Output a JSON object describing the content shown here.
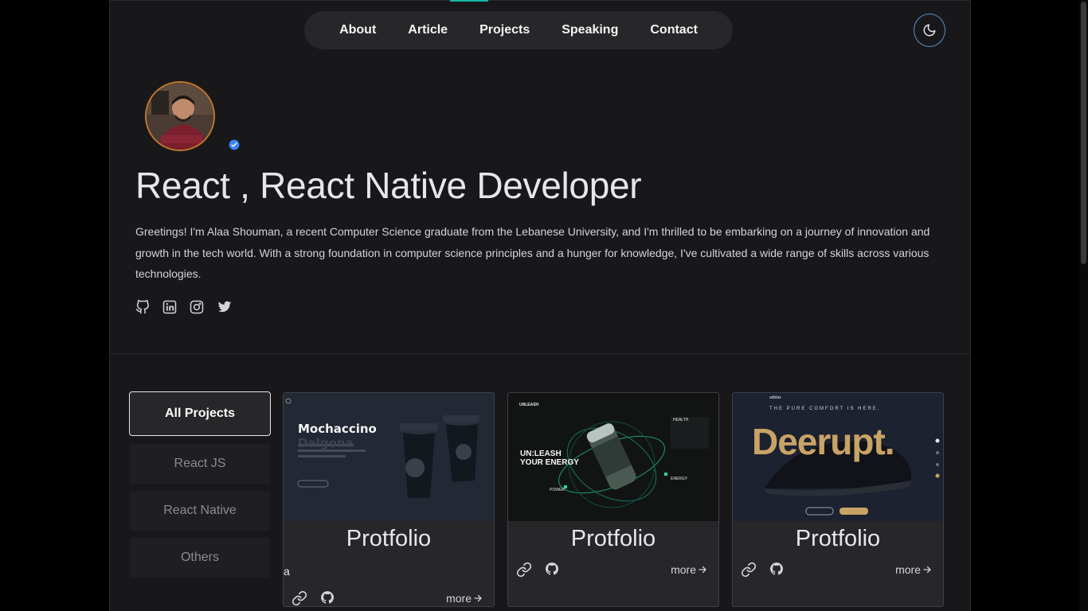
{
  "nav": {
    "items": [
      "About",
      "Article",
      "Projects",
      "Speaking",
      "Contact"
    ]
  },
  "hero": {
    "headline": "React , React Native Developer",
    "bio": "Greetings! I'm Alaa Shouman, a recent Computer Science graduate from the Lebanese University, and I'm thrilled to be embarking on a journey of innovation and growth in the tech world. With a strong foundation in computer science principles and a hunger for knowledge, I've cultivated a wide range of skills across various technologies."
  },
  "socials": [
    "github-icon",
    "linkedin-icon",
    "instagram-icon",
    "twitter-icon"
  ],
  "filters": [
    "All Projects",
    "React JS",
    "React Native",
    "Others"
  ],
  "cards": [
    {
      "title": "Protfolio",
      "sub": "a",
      "more": "more",
      "thumb_heading": "Mochaccino",
      "thumb_sub": "Dalgona"
    },
    {
      "title": "Protfolio",
      "more": "more",
      "thumb_heading": "UN:LEASH",
      "thumb_sub": "YOUR ENERGY",
      "thumb_brand": "UNLEASH",
      "thumb_tag": "HEALTH",
      "thumb_power": "POWER",
      "thumb_energy": "ENERGY"
    },
    {
      "title": "Protfolio",
      "more": "more",
      "thumb_heading": "Deerupt.",
      "thumb_sub": "THE PURE COMFORT IS HERE.",
      "thumb_brand": "adidas"
    }
  ],
  "colors": {
    "accent": "#14b8a6",
    "avatar_ring": "#c2772b",
    "verified": "#3b82f6",
    "theme_ring": "#5b8cc9"
  }
}
